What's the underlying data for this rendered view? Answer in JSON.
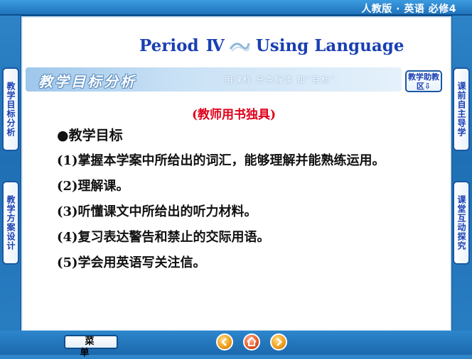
{
  "header": {
    "title": "人教版 · 英语  必修4"
  },
  "lesson": {
    "period": "Period",
    "roman": "Ⅳ",
    "topic": "Using Language"
  },
  "banner": {
    "title": "教学目标分析",
    "subtitle": "明课标  分条解读  知“目标”",
    "help_button": "教学助教区⇩"
  },
  "note": "(教师用书独具)",
  "objectives": {
    "heading": "●教学目标",
    "items": [
      "(1)掌握本学案中所给出的词汇，能够理解并能熟练运用。",
      "(2)理解课。",
      "(3)听懂课文中所给出的听力材料。",
      "(4)复习表达警告和禁止的交际用语。",
      "(5)学会用英语写关注信。"
    ]
  },
  "left_tabs": [
    "教学目标分析",
    "教学方案设计"
  ],
  "right_tabs": [
    "课前自主导学",
    "课堂互动探究"
  ],
  "bottom": {
    "menu_label": "菜单",
    "nav_icons": [
      "back-icon",
      "home-icon",
      "forward-icon"
    ]
  },
  "colors": {
    "frame_blue": "#1f6fb4",
    "title_blue": "#1a3fb3",
    "note_red": "#e0001b"
  }
}
